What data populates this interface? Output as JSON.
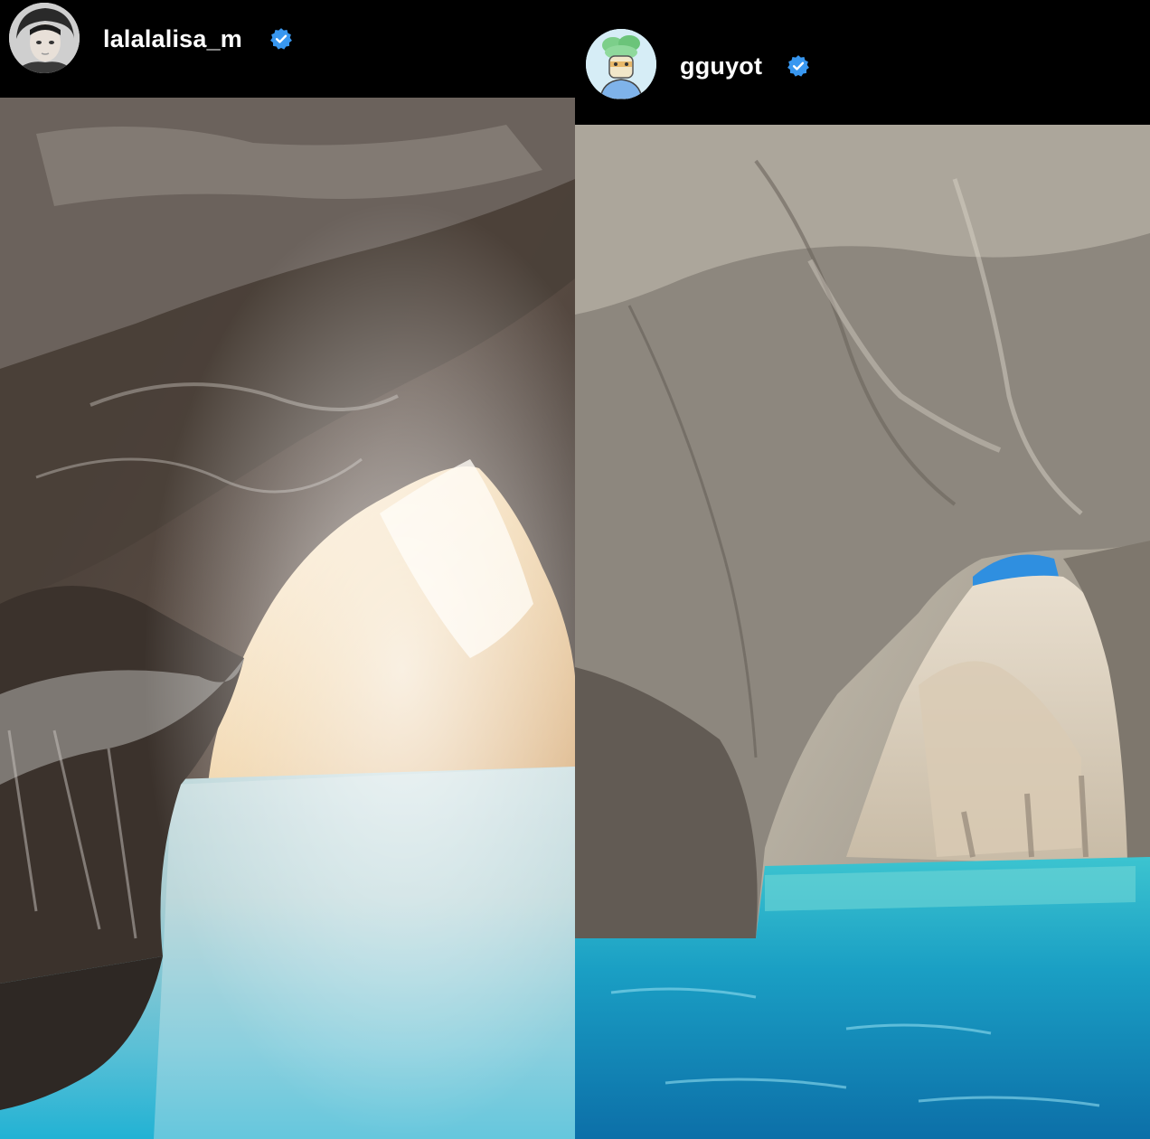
{
  "posts": [
    {
      "username": "lalalalisa_m",
      "verified": true,
      "avatar_icon": "profile-photo-icon",
      "photo_description_icon": "sea-cave-photo-icon"
    },
    {
      "username": "gguyot",
      "verified": true,
      "avatar_icon": "cartoon-avatar-icon",
      "photo_description_icon": "rock-arch-photo-icon"
    }
  ],
  "colors": {
    "background": "#000000",
    "verified_badge": "#3897f0",
    "text": "#ffffff",
    "water": "#1aa7c7"
  }
}
